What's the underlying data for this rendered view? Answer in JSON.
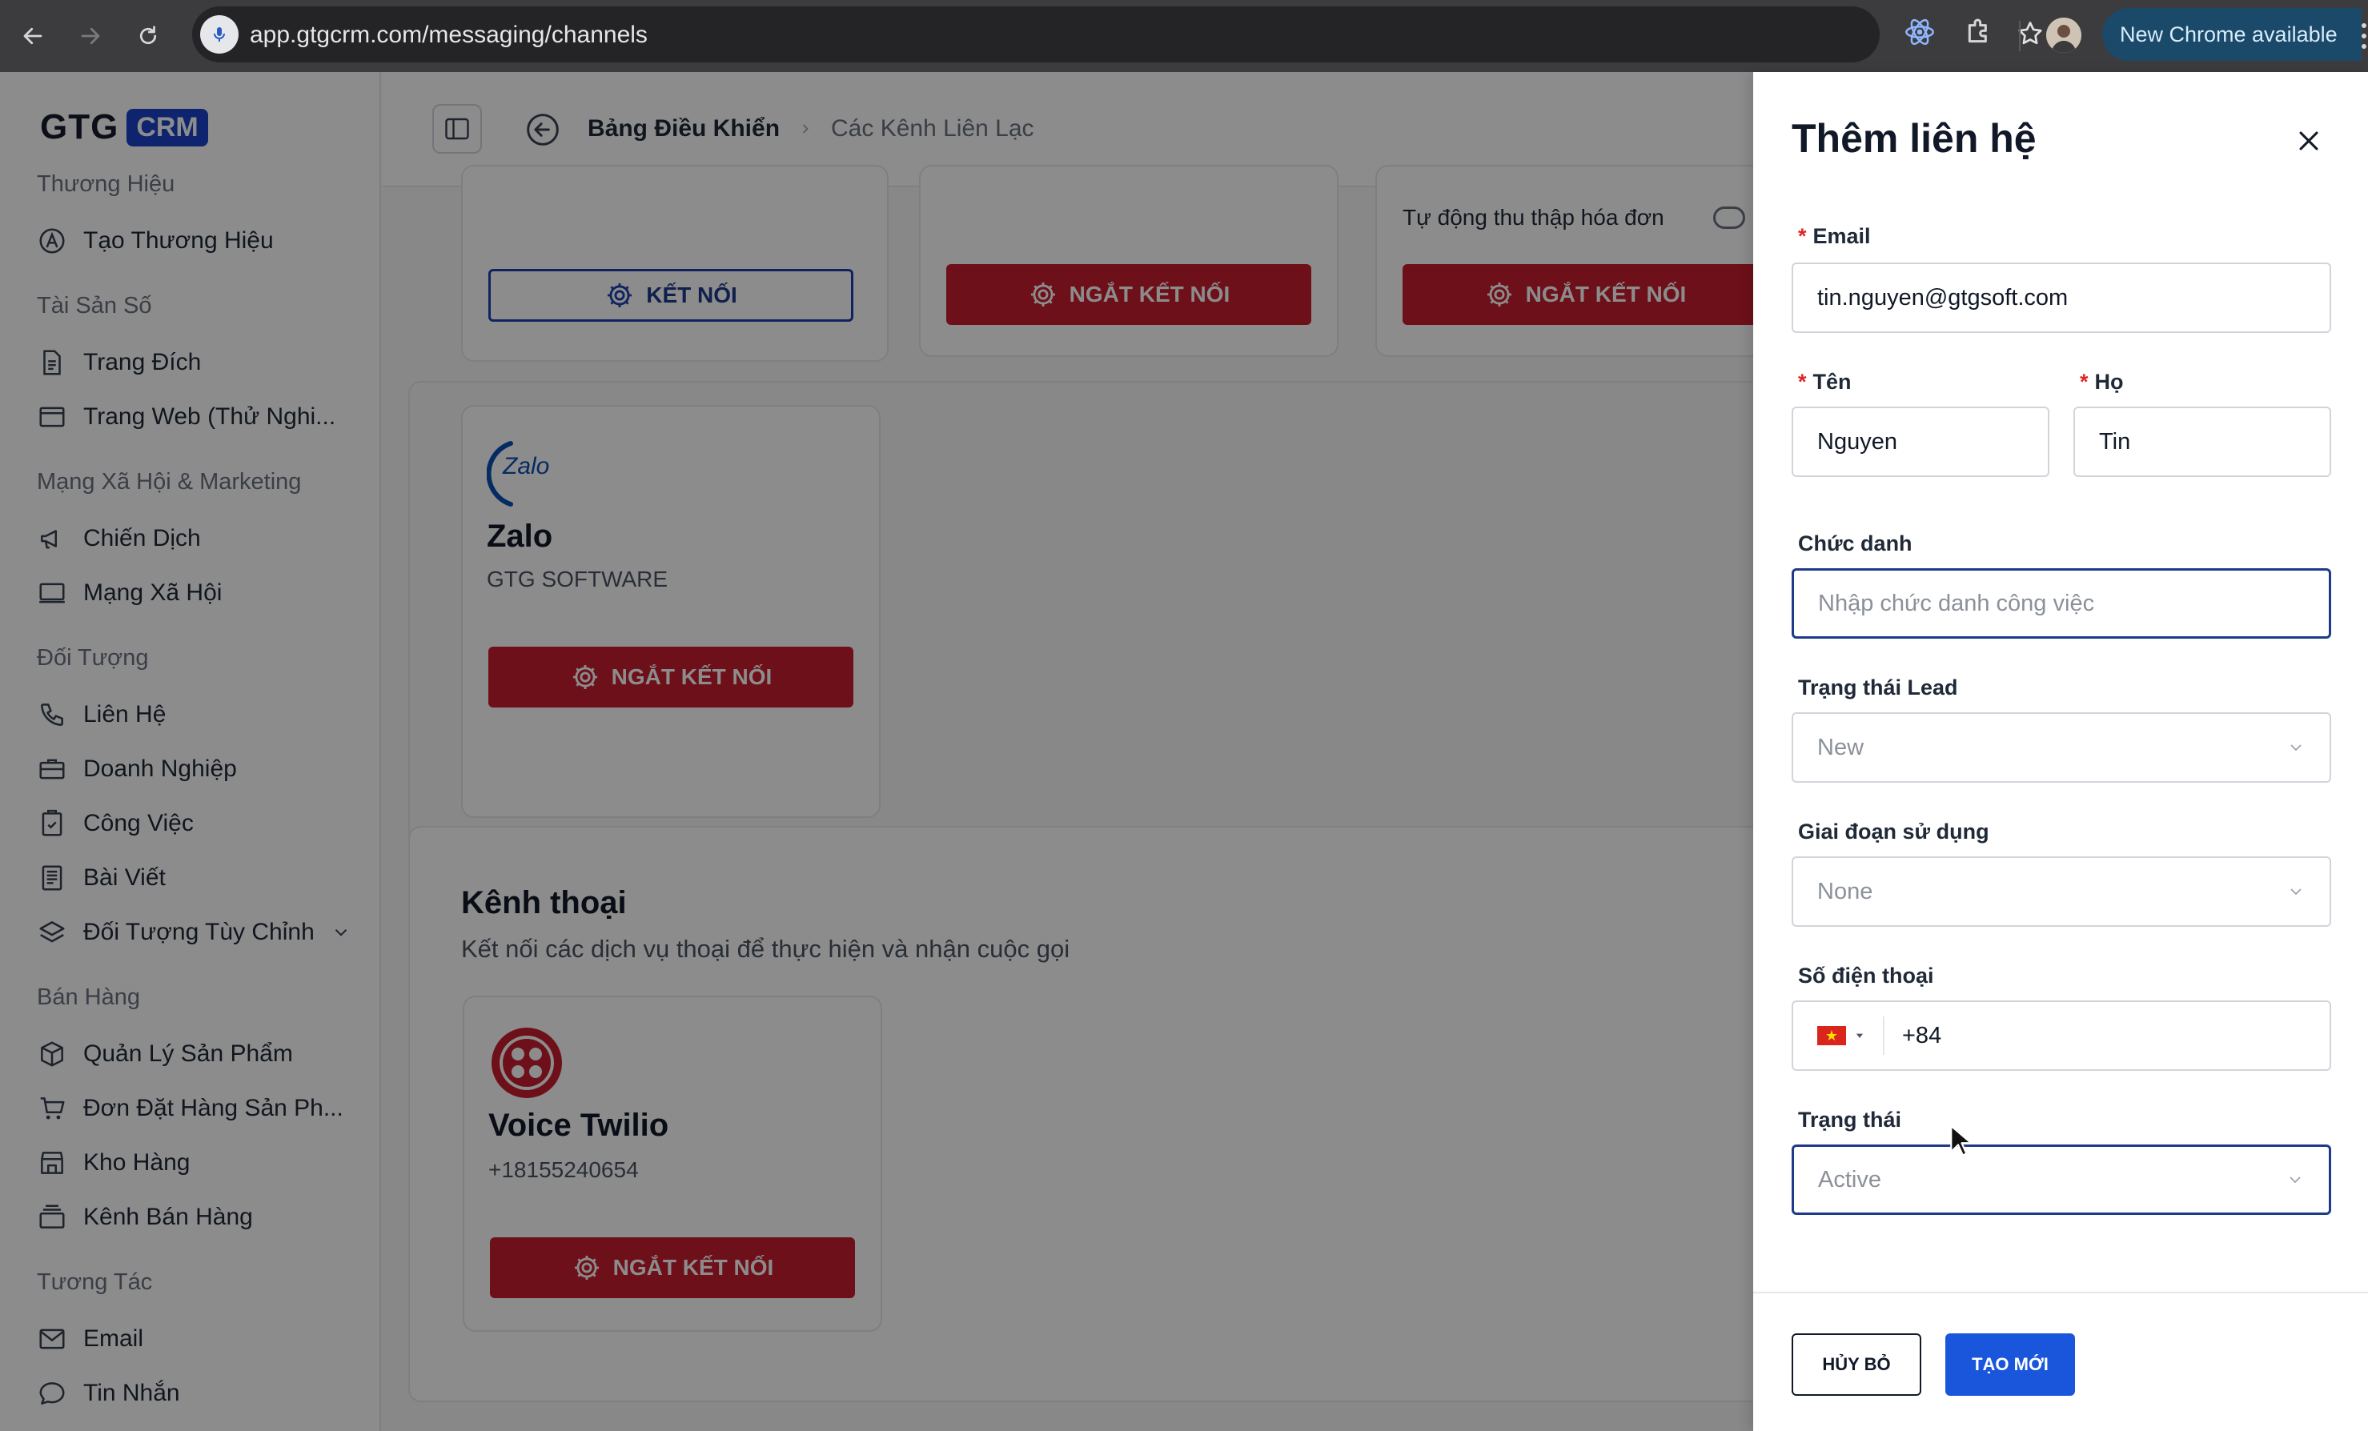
{
  "browser": {
    "url": "app.gtgcrm.com/messaging/channels",
    "new_chrome_label": "New Chrome available"
  },
  "logo": {
    "brand": "GTG",
    "badge": "CRM"
  },
  "sidebar": {
    "sections": [
      {
        "title": "Thương Hiệu",
        "items": [
          "Tạo Thương Hiệu"
        ]
      },
      {
        "title": "Tài Sản Số",
        "items": [
          "Trang Đích",
          "Trang Web (Thử Nghi..."
        ]
      },
      {
        "title": "Mạng Xã Hội & Marketing",
        "items": [
          "Chiến Dịch",
          "Mạng Xã Hội"
        ]
      },
      {
        "title": "Đối Tượng",
        "items": [
          "Liên Hệ",
          "Doanh Nghiệp",
          "Công Việc",
          "Bài Viết",
          "Đối Tượng Tùy Chỉnh"
        ]
      },
      {
        "title": "Bán Hàng",
        "items": [
          "Quản Lý Sản Phẩm",
          "Đơn Đặt Hàng Sản Ph...",
          "Kho Hàng",
          "Kênh Bán Hàng"
        ]
      },
      {
        "title": "Tương Tác",
        "items": [
          "Email",
          "Tin Nhắn"
        ]
      }
    ]
  },
  "breadcrumb": {
    "home": "Bảng Điều Khiển",
    "current": "Các Kênh Liên Lạc"
  },
  "channels": {
    "connect_label": "KẾT NỐI",
    "disconnect_label": "NGẮT KẾT NỐI",
    "auto_invoice_label": "Tự động thu thập hóa đơn",
    "zalo": {
      "logo_text": "Zalo",
      "name": "Zalo",
      "account": "GTG SOFTWARE"
    },
    "voice_section": {
      "title": "Kênh thoại",
      "subtitle": "Kết nối các dịch vụ thoại để thực hiện và nhận cuộc gọi"
    },
    "twilio": {
      "name": "Voice Twilio",
      "number": "+18155240654"
    }
  },
  "drawer": {
    "title": "Thêm liên hệ",
    "required_mark": "*",
    "email": {
      "label": "Email",
      "value": "tin.nguyen@gtgsoft.com"
    },
    "first_name": {
      "label": "Tên",
      "value": "Nguyen"
    },
    "last_name": {
      "label": "Họ",
      "value": "Tin"
    },
    "job_title": {
      "label": "Chức danh",
      "placeholder": "Nhập chức danh công việc"
    },
    "lead_status": {
      "label": "Trạng thái Lead",
      "value": "New"
    },
    "lifecycle": {
      "label": "Giai đoạn sử dụng",
      "value": "None"
    },
    "phone": {
      "label": "Số điện thoại",
      "value": "+84",
      "country_icon": "vietnam-flag-icon"
    },
    "status": {
      "label": "Trạng thái",
      "value": "Active"
    },
    "cancel_label": "HỦY BỎ",
    "create_label": "TẠO MỚI"
  },
  "colors": {
    "brand_blue": "#1a43c8",
    "danger": "#c81e2e",
    "primary_button": "#1a56db",
    "focus_border": "#1e3a8a"
  }
}
